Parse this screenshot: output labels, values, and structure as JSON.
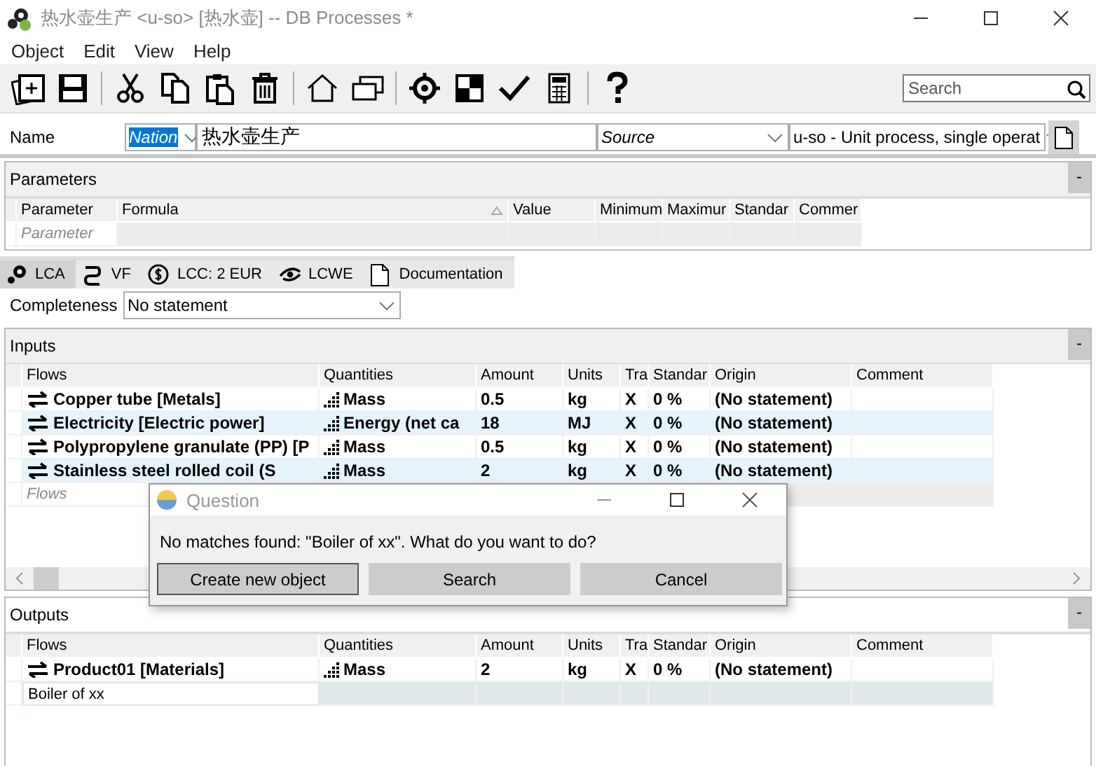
{
  "window": {
    "title": "热水壶生产 <u-so> [热水壶] -- DB Processes *"
  },
  "menu": [
    "Object",
    "Edit",
    "View",
    "Help"
  ],
  "search": {
    "placeholder": "Search"
  },
  "name_row": {
    "label": "Name",
    "nation": "Nation",
    "value": "热水壶生产",
    "source": "Source",
    "process_type": "u-so - Unit process, single operat"
  },
  "parameters": {
    "title": "Parameters",
    "collapse": "-",
    "columns": [
      "Parameter",
      "Formula",
      "Value",
      "Minimum",
      "Maximur",
      "Standar",
      "Commer"
    ],
    "placeholder": "Parameter"
  },
  "tabs": [
    {
      "label": "LCA",
      "selected": true
    },
    {
      "label": "VF",
      "selected": false
    },
    {
      "label": "LCC: 2 EUR",
      "selected": false
    },
    {
      "label": "LCWE",
      "selected": false
    },
    {
      "label": "Documentation",
      "selected": false
    }
  ],
  "completeness": {
    "label": "Completeness",
    "value": "No statement"
  },
  "inputs": {
    "title": "Inputs",
    "collapse": "-",
    "columns": [
      "Flows",
      "Quantities",
      "Amount",
      "Units",
      "Tra",
      "Standar",
      "Origin",
      "Comment"
    ],
    "rows": [
      {
        "flow": "Copper tube [Metals]",
        "quantity": "Mass",
        "amount": "0.5",
        "unit": "kg",
        "tra": "X",
        "standard": "0 %",
        "origin": "(No statement)"
      },
      {
        "flow": "Electricity [Electric power]",
        "quantity": "Energy (net ca",
        "amount": "18",
        "unit": "MJ",
        "tra": "X",
        "standard": "0 %",
        "origin": "(No statement)"
      },
      {
        "flow": "Polypropylene granulate (PP) [P",
        "quantity": "Mass",
        "amount": "0.5",
        "unit": "kg",
        "tra": "X",
        "standard": "0 %",
        "origin": "(No statement)"
      },
      {
        "flow": "Stainless steel rolled coil (S",
        "quantity": "Mass",
        "amount": "2",
        "unit": "kg",
        "tra": "X",
        "standard": "0 %",
        "origin": "(No statement)"
      }
    ],
    "placeholder": "Flows"
  },
  "outputs": {
    "title": "Outputs",
    "collapse": "-",
    "columns": [
      "Flows",
      "Quantities",
      "Amount",
      "Units",
      "Tra",
      "Standar",
      "Origin",
      "Comment"
    ],
    "rows": [
      {
        "flow": "Product01 [Materials]",
        "quantity": "Mass",
        "amount": "2",
        "unit": "kg",
        "tra": "X",
        "standard": "0 %",
        "origin": "(No statement)"
      }
    ],
    "new_row": "Boiler of xx"
  },
  "dialog": {
    "title": "Question",
    "message": "No matches found: \"Boiler of xx\". What do you want to do?",
    "buttons": [
      {
        "label": "Create new object",
        "focused": true
      },
      {
        "label": "Search",
        "focused": false
      },
      {
        "label": "Cancel",
        "focused": false
      }
    ]
  }
}
